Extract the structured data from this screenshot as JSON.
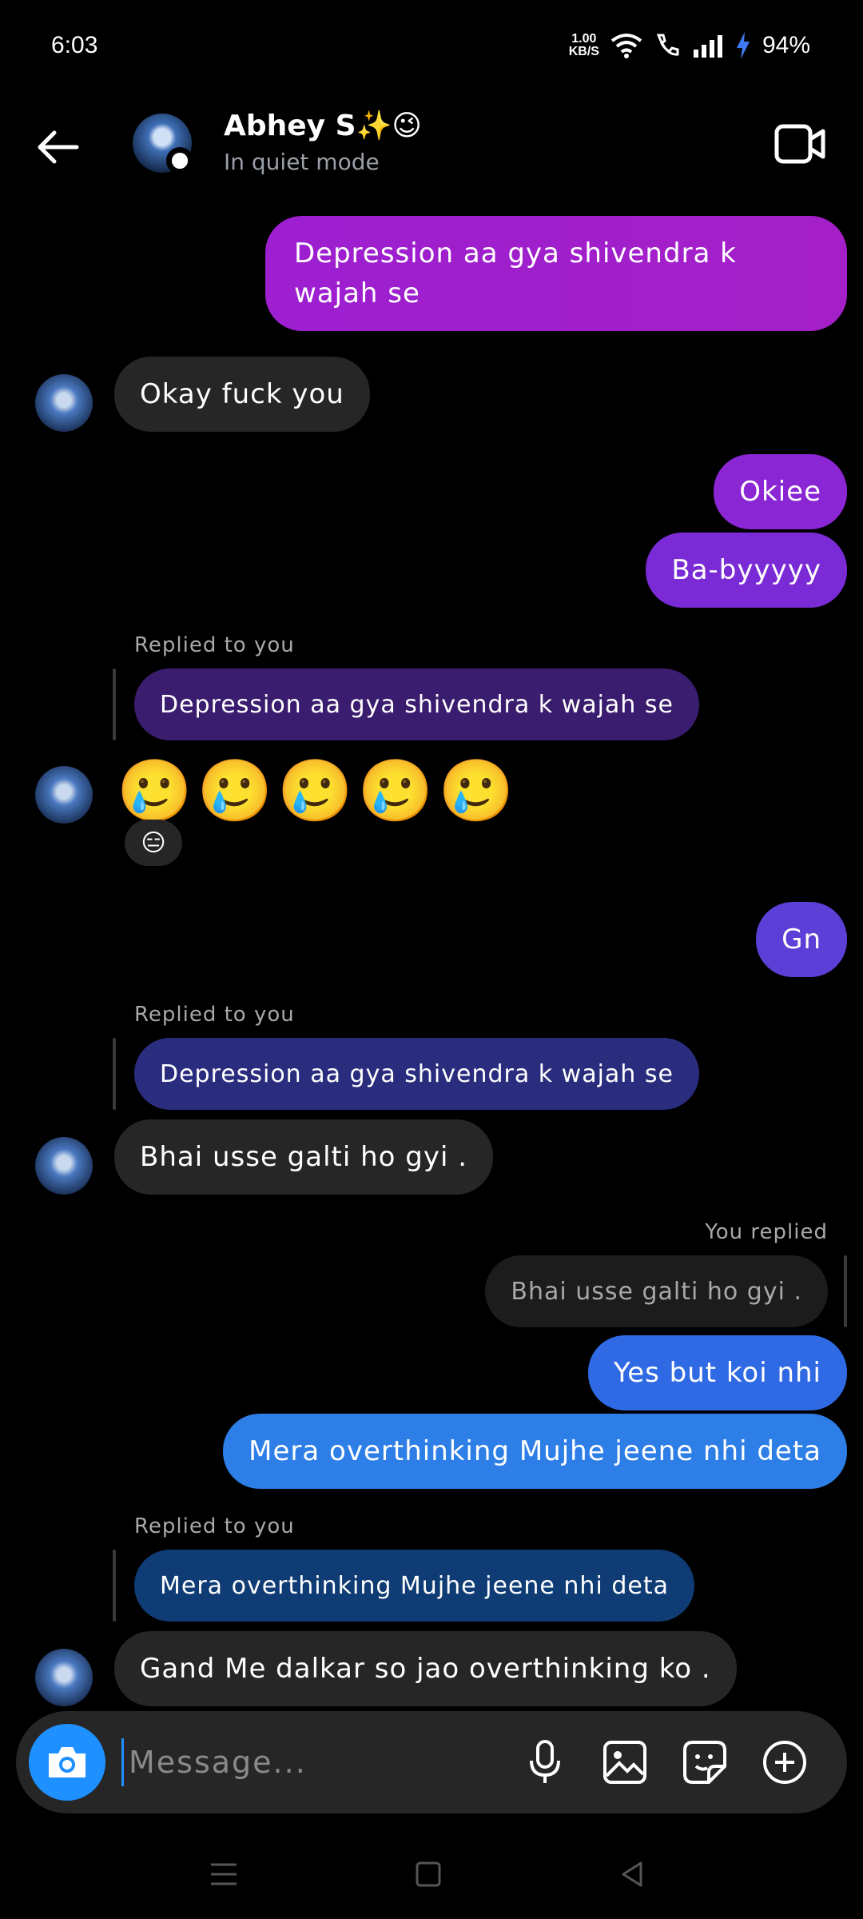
{
  "status_bar": {
    "time": "6:03",
    "net_speed_value": "1.00",
    "net_speed_unit": "KB/S",
    "battery": "94%"
  },
  "header": {
    "name": "Abhey S✨😉",
    "status": "In quiet mode"
  },
  "messages": {
    "m1": "Depression aa gya shivendra k wajah se",
    "m2": "Okay fuck you",
    "m3": "Okiee",
    "m4": "Ba-byyyyy",
    "r1_label": "Replied to you",
    "r1_quote": "Depression aa gya shivendra k wajah se",
    "m5_emojis": "🥲🥲🥲🥲🥲",
    "m5_reaction": "😑",
    "m6": "Gn",
    "r2_label": "Replied to you",
    "r2_quote": "Depression aa gya shivendra k wajah se",
    "m7": "Bhai usse galti ho gyi .",
    "r3_label": "You replied",
    "r3_quote": "Bhai usse galti ho gyi .",
    "m8": "Yes but koi nhi",
    "m9": "Mera overthinking Mujhe jeene nhi deta",
    "r4_label": "Replied to you",
    "r4_quote": "Mera overthinking Mujhe jeene nhi deta",
    "m10": "Gand Me dalkar so jao overthinking ko ."
  },
  "composer": {
    "placeholder": "Message..."
  },
  "colors": {
    "purple1": "#9b1fd0",
    "purple2": "#7a2bd6",
    "indigo": "#5b3fd6",
    "blue": "#2f6fe8",
    "camera": "#1e90ff"
  },
  "icons": [
    "back-arrow-icon",
    "video-call-icon",
    "camera-icon",
    "microphone-icon",
    "gallery-icon",
    "sticker-icon",
    "plus-icon",
    "menu-icon",
    "home-icon",
    "back-triangle-icon"
  ]
}
